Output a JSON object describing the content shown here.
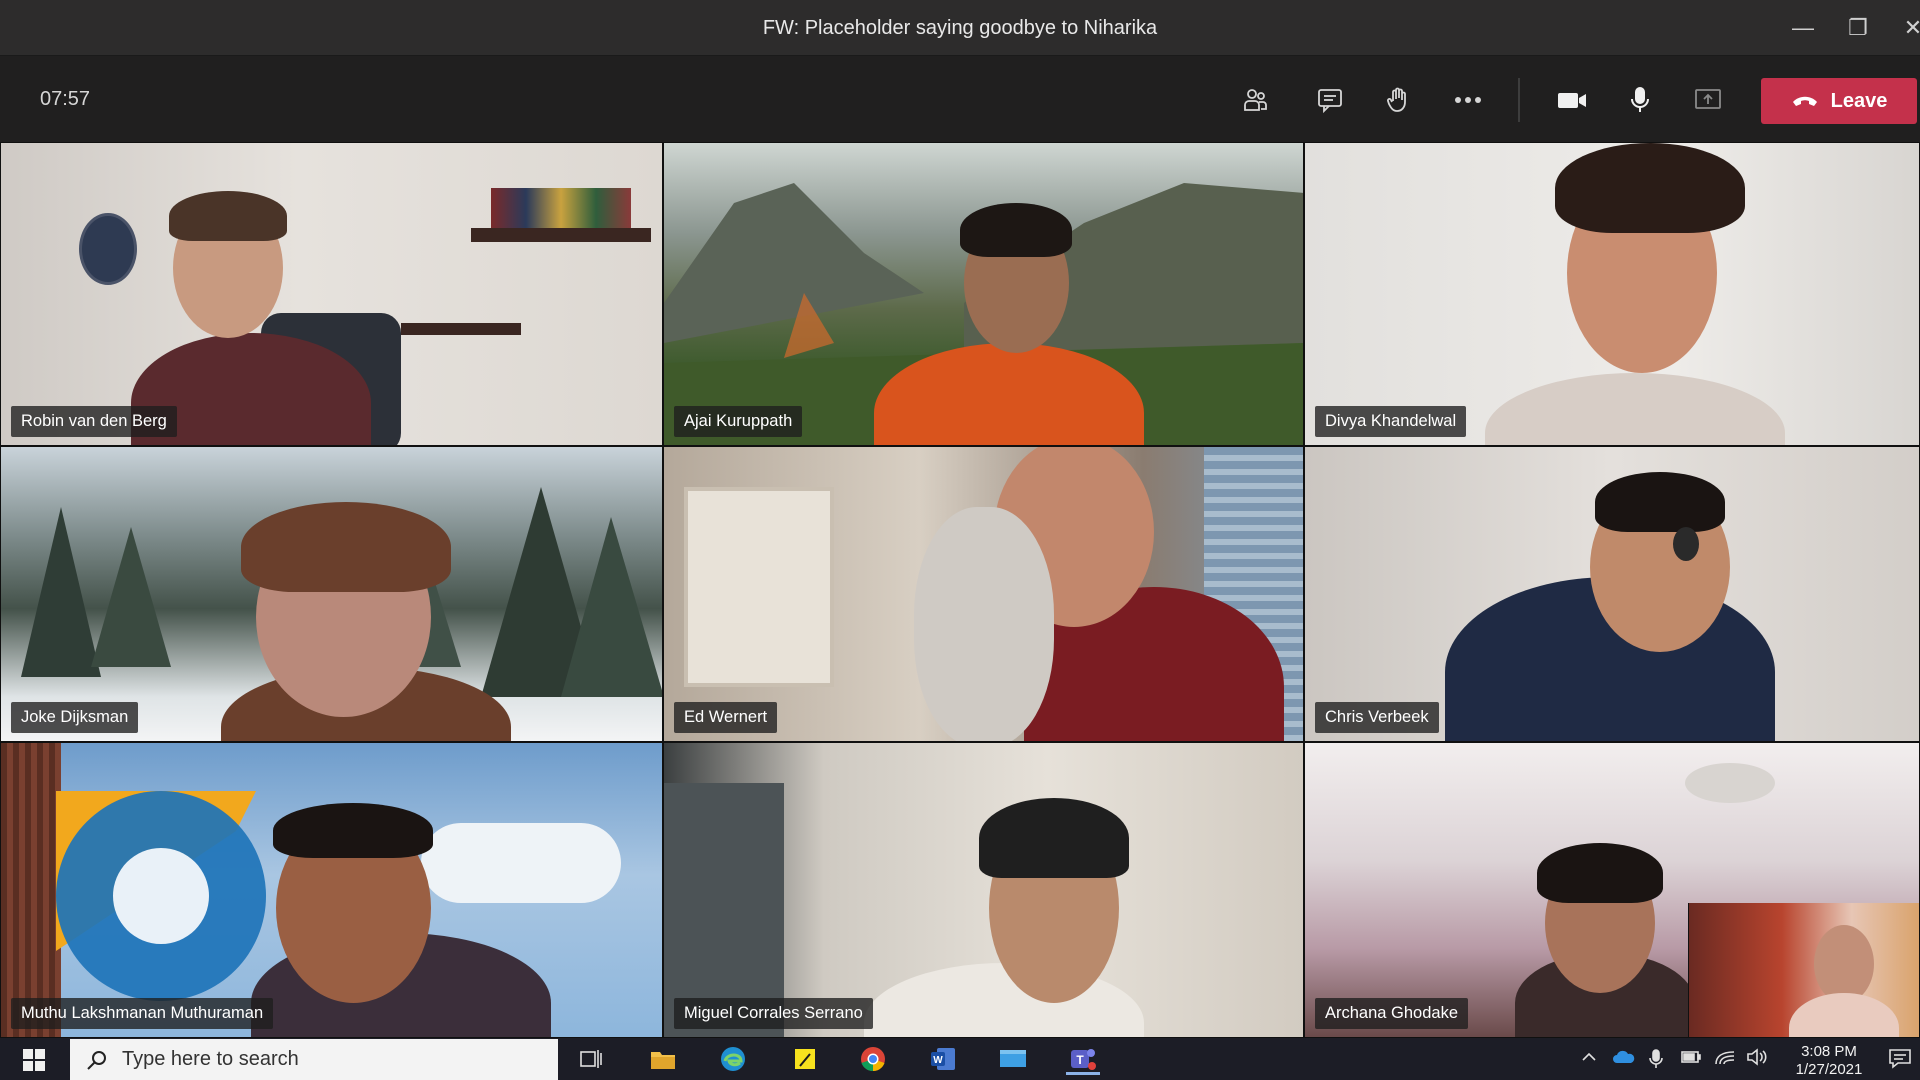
{
  "window": {
    "title": "FW: Placeholder saying goodbye to Niharika",
    "minimize_glyph": "—",
    "maximize_glyph": "❐",
    "close_glyph": "✕"
  },
  "toolbar": {
    "timer": "07:57",
    "leave_label": "Leave",
    "icons": [
      "participants-icon",
      "chat-icon",
      "raise-hand-icon",
      "more-options-icon",
      "camera-icon",
      "microphone-icon",
      "share-screen-icon"
    ]
  },
  "participants": [
    {
      "name": "Robin van den Berg"
    },
    {
      "name": "Ajai Kuruppath"
    },
    {
      "name": "Divya Khandelwal"
    },
    {
      "name": "Joke Dijksman"
    },
    {
      "name": "Ed Wernert"
    },
    {
      "name": "Chris Verbeek"
    },
    {
      "name": "Muthu Lakshmanan Muthuraman"
    },
    {
      "name": "Miguel Corrales Serrano"
    },
    {
      "name": "Archana Ghodake"
    }
  ],
  "taskbar": {
    "search_placeholder": "Type here to search",
    "time": "3:08 PM",
    "date": "1/27/2021",
    "apps": [
      "task-view-icon",
      "file-explorer-icon",
      "edge-icon",
      "sticky-notes-icon",
      "chrome-icon",
      "word-icon",
      "desktop-app-icon",
      "teams-icon"
    ]
  },
  "colors": {
    "leave": "#c4314b",
    "titlebar": "#2d2c2c",
    "toolbar": "#201f1f",
    "taskbar": "#1c1d26"
  }
}
